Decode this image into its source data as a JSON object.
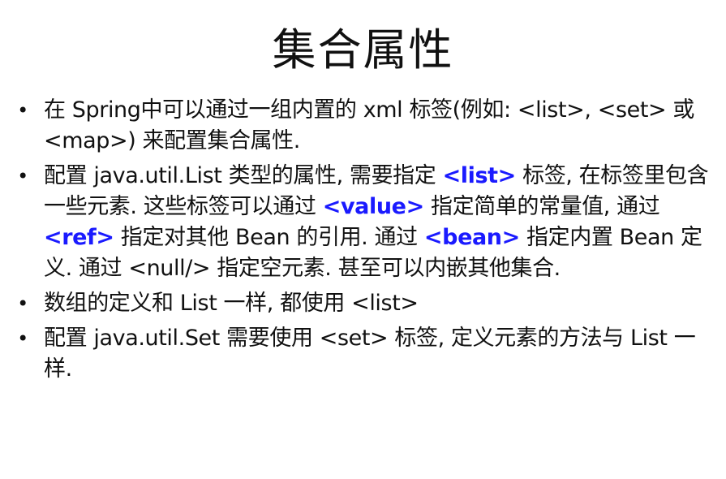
{
  "title": "集合属性",
  "bullets": [
    {
      "id": "b1",
      "segments": [
        {
          "text": "在 Spring中可以通过一组内置的 xml 标签(例如: <list>, <set> 或 <map>) 来配置集合属性.",
          "style": "normal"
        }
      ]
    },
    {
      "id": "b2",
      "segments": [
        {
          "text": "配置 java.util.List 类型的属性, 需要指定 ",
          "style": "normal"
        },
        {
          "text": "<list>",
          "style": "tag"
        },
        {
          "text": "  标签, 在标签里包含一些元素. 这些标签可以通过 ",
          "style": "normal"
        },
        {
          "text": "<value>",
          "style": "tag"
        },
        {
          "text": " 指定简单的常量值, 通过 ",
          "style": "normal"
        },
        {
          "text": "<ref>",
          "style": "tag"
        },
        {
          "text": " 指定对其他 Bean 的引用. 通过 ",
          "style": "normal"
        },
        {
          "text": "<bean>",
          "style": "tag"
        },
        {
          "text": " 指定内置 Bean 定义. 通过 <null/> 指定空元素. 甚至可以内嵌其他集合.",
          "style": "normal"
        }
      ]
    },
    {
      "id": "b3",
      "segments": [
        {
          "text": "数组的定义和 List 一样, 都使用 <list>",
          "style": "normal"
        }
      ]
    },
    {
      "id": "b4",
      "segments": [
        {
          "text": "配置 java.util.Set 需要使用 <set> 标签, 定义元素的方法与 List 一样.",
          "style": "normal"
        }
      ]
    }
  ],
  "colors": {
    "text": "#111111",
    "tag_highlight": "#1a1aff",
    "background": "#ffffff"
  },
  "bullet_glyph": "•"
}
